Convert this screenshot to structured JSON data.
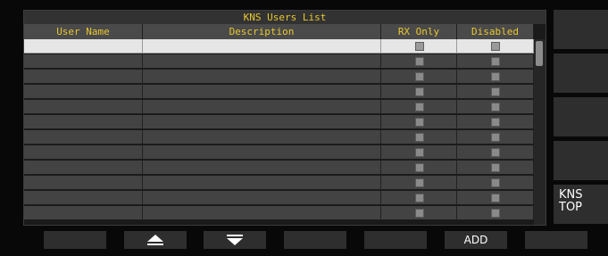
{
  "window": {
    "title": "KNS Users List"
  },
  "columns": [
    "User Name",
    "Description",
    "RX Only",
    "Disabled"
  ],
  "rows": [
    {
      "user_name": "",
      "description": "",
      "rx_only": false,
      "disabled": false,
      "selected": true
    },
    {
      "user_name": "",
      "description": "",
      "rx_only": false,
      "disabled": false
    },
    {
      "user_name": "",
      "description": "",
      "rx_only": false,
      "disabled": false
    },
    {
      "user_name": "",
      "description": "",
      "rx_only": false,
      "disabled": false
    },
    {
      "user_name": "",
      "description": "",
      "rx_only": false,
      "disabled": false
    },
    {
      "user_name": "",
      "description": "",
      "rx_only": false,
      "disabled": false
    },
    {
      "user_name": "",
      "description": "",
      "rx_only": false,
      "disabled": false
    },
    {
      "user_name": "",
      "description": "",
      "rx_only": false,
      "disabled": false
    },
    {
      "user_name": "",
      "description": "",
      "rx_only": false,
      "disabled": false
    },
    {
      "user_name": "",
      "description": "",
      "rx_only": false,
      "disabled": false
    },
    {
      "user_name": "",
      "description": "",
      "rx_only": false,
      "disabled": false
    },
    {
      "user_name": "",
      "description": "",
      "rx_only": false,
      "disabled": false
    }
  ],
  "side_keys": [
    "",
    "",
    "",
    "",
    "KNS\nTOP"
  ],
  "function_keys": [
    {
      "label": "",
      "icon": ""
    },
    {
      "label": "",
      "icon": "scroll-up-icon"
    },
    {
      "label": "",
      "icon": "scroll-down-icon"
    },
    {
      "label": "",
      "icon": ""
    },
    {
      "label": "",
      "icon": ""
    },
    {
      "label": "ADD",
      "icon": ""
    },
    {
      "label": "",
      "icon": ""
    }
  ],
  "colors": {
    "title_text": "#e8c830",
    "header_bg": "#4a4a4a",
    "row_bg": "#434343",
    "selected_row_bg": "#e6e6e6",
    "key_bg": "#2e2e2e"
  }
}
